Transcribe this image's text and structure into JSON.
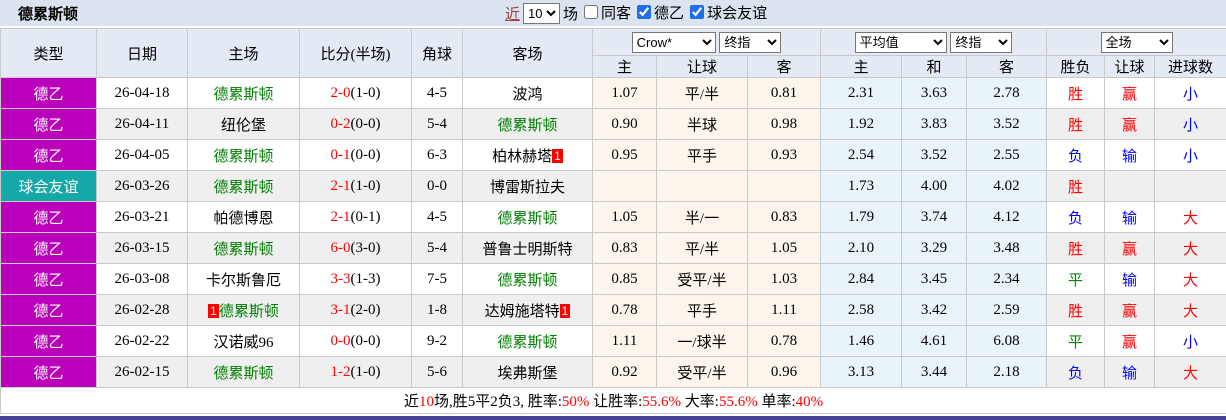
{
  "title": "德累斯顿",
  "controls": {
    "recent_label": "近",
    "recent_count": "10",
    "matches_label": "场",
    "checkboxes": [
      {
        "label": "同客",
        "checked": false
      },
      {
        "label": "德乙",
        "checked": true
      },
      {
        "label": "球会友谊",
        "checked": true
      }
    ]
  },
  "header": {
    "match_cols": [
      "类型",
      "日期",
      "主场",
      "比分(半场)",
      "角球",
      "客场"
    ],
    "handicap_selects": [
      "Crow*",
      "终指"
    ],
    "odds_selects": [
      "平均值",
      "终指"
    ],
    "result_select": "全场",
    "handicap_cols": [
      "主",
      "让球",
      "客"
    ],
    "odds_cols": [
      "主",
      "和",
      "客"
    ],
    "result_cols": [
      "胜负",
      "让球",
      "进球数"
    ]
  },
  "rows": [
    {
      "type": "德乙",
      "type_class": "league",
      "date": "26-04-18",
      "home": {
        "name": "德累斯顿",
        "green": true
      },
      "score": {
        "full": "2-0",
        "half": "(1-0)"
      },
      "corner": "4-5",
      "away": {
        "name": "波鸿",
        "green": false
      },
      "let": [
        "1.07",
        "平/半",
        "0.81"
      ],
      "avg": [
        "2.31",
        "3.63",
        "2.78"
      ],
      "result": [
        {
          "t": "胜",
          "c": "r"
        },
        {
          "t": "赢",
          "c": "r"
        },
        {
          "t": "小",
          "c": "b"
        }
      ]
    },
    {
      "type": "德乙",
      "type_class": "league",
      "date": "26-04-11",
      "home": {
        "name": "纽伦堡",
        "green": false
      },
      "score": {
        "full": "0-2",
        "half": "(0-0)"
      },
      "corner": "5-4",
      "away": {
        "name": "德累斯顿",
        "green": true
      },
      "let": [
        "0.90",
        "半球",
        "0.98"
      ],
      "avg": [
        "1.92",
        "3.83",
        "3.52"
      ],
      "result": [
        {
          "t": "胜",
          "c": "r"
        },
        {
          "t": "赢",
          "c": "r"
        },
        {
          "t": "小",
          "c": "b"
        }
      ]
    },
    {
      "type": "德乙",
      "type_class": "league",
      "date": "26-04-05",
      "home": {
        "name": "德累斯顿",
        "green": true
      },
      "score": {
        "full": "0-1",
        "half": "(0-0)"
      },
      "corner": "6-3",
      "away": {
        "name": "柏林赫塔",
        "green": false,
        "badge_after": "1"
      },
      "let": [
        "0.95",
        "平手",
        "0.93"
      ],
      "avg": [
        "2.54",
        "3.52",
        "2.55"
      ],
      "result": [
        {
          "t": "负",
          "c": "b"
        },
        {
          "t": "输",
          "c": "b"
        },
        {
          "t": "小",
          "c": "b"
        }
      ]
    },
    {
      "type": "球会友谊",
      "type_class": "friendly",
      "date": "26-03-26",
      "home": {
        "name": "德累斯顿",
        "green": true
      },
      "score": {
        "full": "2-1",
        "half": "(1-0)"
      },
      "corner": "0-0",
      "away": {
        "name": "博雷斯拉夫",
        "green": false
      },
      "let": [
        "",
        "",
        ""
      ],
      "avg": [
        "1.73",
        "4.00",
        "4.02"
      ],
      "result": [
        {
          "t": "胜",
          "c": "r"
        },
        {
          "t": "",
          "c": ""
        },
        {
          "t": "",
          "c": ""
        }
      ]
    },
    {
      "type": "德乙",
      "type_class": "league",
      "date": "26-03-21",
      "home": {
        "name": "帕德博恩",
        "green": false
      },
      "score": {
        "full": "2-1",
        "half": "(0-1)"
      },
      "corner": "4-5",
      "away": {
        "name": "德累斯顿",
        "green": true
      },
      "let": [
        "1.05",
        "半/一",
        "0.83"
      ],
      "avg": [
        "1.79",
        "3.74",
        "4.12"
      ],
      "result": [
        {
          "t": "负",
          "c": "b"
        },
        {
          "t": "输",
          "c": "b"
        },
        {
          "t": "大",
          "c": "r"
        }
      ]
    },
    {
      "type": "德乙",
      "type_class": "league",
      "date": "26-03-15",
      "home": {
        "name": "德累斯顿",
        "green": true
      },
      "score": {
        "full": "6-0",
        "half": "(3-0)"
      },
      "corner": "5-4",
      "away": {
        "name": "普鲁士明斯特",
        "green": false
      },
      "let": [
        "0.83",
        "平/半",
        "1.05"
      ],
      "avg": [
        "2.10",
        "3.29",
        "3.48"
      ],
      "result": [
        {
          "t": "胜",
          "c": "r"
        },
        {
          "t": "赢",
          "c": "r"
        },
        {
          "t": "大",
          "c": "r"
        }
      ]
    },
    {
      "type": "德乙",
      "type_class": "league",
      "date": "26-03-08",
      "home": {
        "name": "卡尔斯鲁厄",
        "green": false
      },
      "score": {
        "full": "3-3",
        "half": "(1-3)"
      },
      "corner": "7-5",
      "away": {
        "name": "德累斯顿",
        "green": true
      },
      "let": [
        "0.85",
        "受平/半",
        "1.03"
      ],
      "avg": [
        "2.84",
        "3.45",
        "2.34"
      ],
      "result": [
        {
          "t": "平",
          "c": "g"
        },
        {
          "t": "输",
          "c": "b"
        },
        {
          "t": "大",
          "c": "r"
        }
      ]
    },
    {
      "type": "德乙",
      "type_class": "league",
      "date": "26-02-28",
      "home": {
        "name": "德累斯顿",
        "green": true,
        "badge_before": "1"
      },
      "score": {
        "full": "3-1",
        "half": "(2-0)"
      },
      "corner": "1-8",
      "away": {
        "name": "达姆施塔特",
        "green": false,
        "badge_after": "1"
      },
      "let": [
        "0.78",
        "平手",
        "1.11"
      ],
      "avg": [
        "2.58",
        "3.42",
        "2.59"
      ],
      "result": [
        {
          "t": "胜",
          "c": "r"
        },
        {
          "t": "赢",
          "c": "r"
        },
        {
          "t": "大",
          "c": "r"
        }
      ]
    },
    {
      "type": "德乙",
      "type_class": "league",
      "date": "26-02-22",
      "home": {
        "name": "汉诺威96",
        "green": false
      },
      "score": {
        "full": "0-0",
        "half": "(0-0)"
      },
      "corner": "9-2",
      "away": {
        "name": "德累斯顿",
        "green": true
      },
      "let": [
        "1.11",
        "一/球半",
        "0.78"
      ],
      "avg": [
        "1.46",
        "4.61",
        "6.08"
      ],
      "result": [
        {
          "t": "平",
          "c": "g"
        },
        {
          "t": "赢",
          "c": "r"
        },
        {
          "t": "小",
          "c": "b"
        }
      ]
    },
    {
      "type": "德乙",
      "type_class": "league",
      "date": "26-02-15",
      "home": {
        "name": "德累斯顿",
        "green": true
      },
      "score": {
        "full": "1-2",
        "half": "(1-0)"
      },
      "corner": "5-6",
      "away": {
        "name": "埃弗斯堡",
        "green": false
      },
      "let": [
        "0.92",
        "受平/半",
        "0.96"
      ],
      "avg": [
        "3.13",
        "3.44",
        "2.18"
      ],
      "result": [
        {
          "t": "负",
          "c": "b"
        },
        {
          "t": "输",
          "c": "b"
        },
        {
          "t": "大",
          "c": "r"
        }
      ]
    }
  ],
  "footer": {
    "segments": [
      {
        "t": "近",
        "red": false
      },
      {
        "t": "10",
        "red": true
      },
      {
        "t": "场,胜5平2负3, 胜率:",
        "red": false
      },
      {
        "t": "50%",
        "red": true
      },
      {
        "t": " 让胜率:",
        "red": false
      },
      {
        "t": "55.6%",
        "red": true
      },
      {
        "t": " 大率:",
        "red": false
      },
      {
        "t": "55.6%",
        "red": true
      },
      {
        "t": " 单率:",
        "red": false
      },
      {
        "t": "40%",
        "red": true
      }
    ]
  },
  "colors": {
    "league_badge": "#BB00BB",
    "friendly_badge": "#14A8A8",
    "win_red": "#FF0000",
    "lose_blue": "#0000FF",
    "draw_green": "#008800",
    "team_green": "#008000",
    "topbar_bg": "#DAE3EF",
    "header_bg": "#E3EAF4",
    "handicap_col_bg": "#FBF5EC",
    "avg_col_bg": "#E9F3FA",
    "alt_row_bg": "#EFEFEF",
    "bottom_bar": "#454295"
  }
}
